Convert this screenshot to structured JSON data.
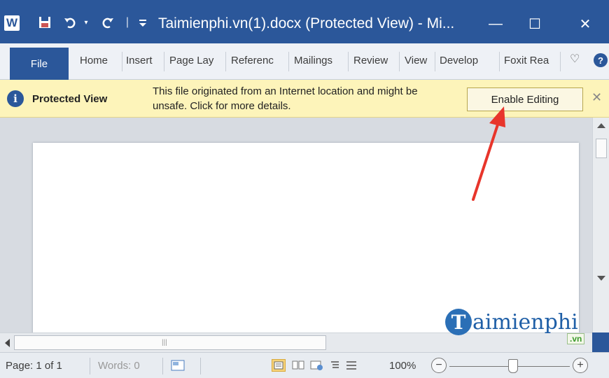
{
  "titlebar": {
    "title": "Taimienphi.vn(1).docx (Protected View) - Mi...",
    "app_logo": "W",
    "minimize": "—",
    "maximize": "☐",
    "close": "✕"
  },
  "ribbon": {
    "file": "File",
    "tabs": [
      "Home",
      "Insert",
      "Page Lay",
      "Referenc",
      "Mailings",
      "Review",
      "View",
      "Develop",
      "Foxit Rea"
    ]
  },
  "message_bar": {
    "label": "Protected View",
    "message": "This file originated from an Internet location and might be unsafe. Click for more details.",
    "button": "Enable Editing",
    "close": "✕"
  },
  "watermark": {
    "initial": "T",
    "text": "aimienphi",
    "suffix": ".vn"
  },
  "status": {
    "page": "Page: 1 of 1",
    "words": "Words: 0",
    "zoom": "100%",
    "zoom_out": "−",
    "zoom_in": "+",
    "zoom_level": 0.5
  }
}
